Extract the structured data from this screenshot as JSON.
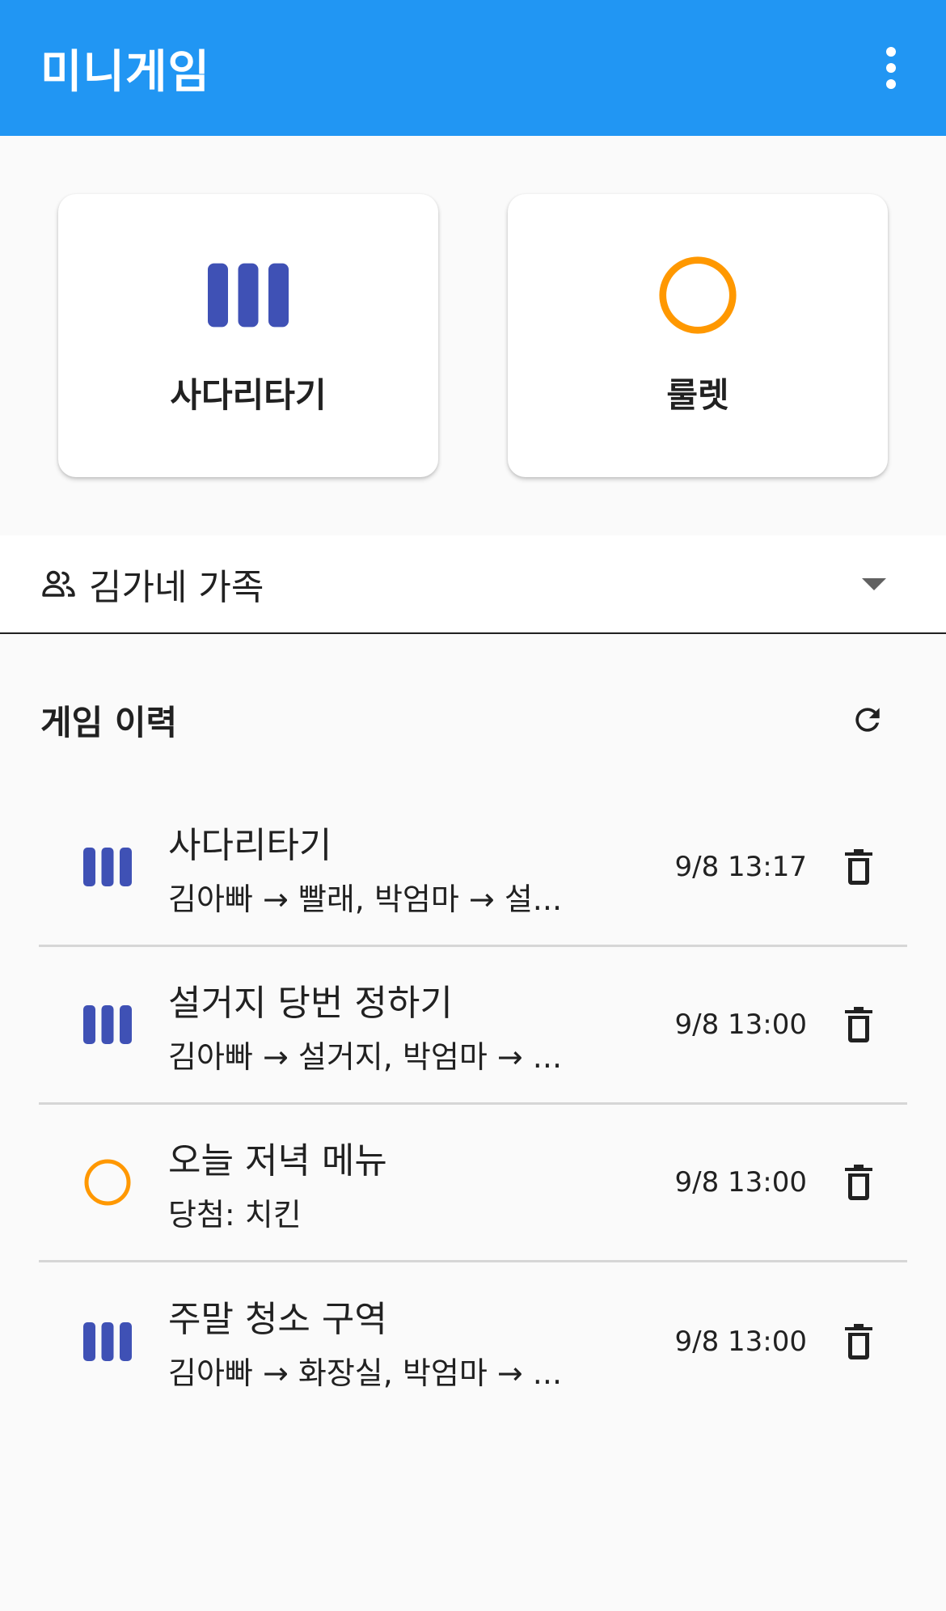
{
  "app": {
    "title": "미니게임",
    "primary_color": "#2196f3",
    "ladder_color": "#3f51b5",
    "roulette_color": "#ff9800"
  },
  "appbar": {
    "menu_icon": "more-vert-icon"
  },
  "games": [
    {
      "label": "사다리타기",
      "icon": "ladder-icon"
    },
    {
      "label": "룰렛",
      "icon": "roulette-icon"
    }
  ],
  "group": {
    "icon": "people-icon",
    "name": "김가네 가족"
  },
  "history": {
    "title": "게임 이력",
    "refresh_icon": "refresh-icon",
    "items": [
      {
        "type": "ladder",
        "icon": "ladder-icon",
        "title": "사다리타기",
        "subtitle": "김아빠 → 빨래, 박엄마 → 설...",
        "time": "9/8 13:17"
      },
      {
        "type": "ladder",
        "icon": "ladder-icon",
        "title": "설거지 당번 정하기",
        "subtitle": "김아빠 → 설거지, 박엄마 → ...",
        "time": "9/8 13:00"
      },
      {
        "type": "roulette",
        "icon": "roulette-icon",
        "title": "오늘 저녁 메뉴",
        "subtitle": "당첨: 치킨",
        "time": "9/8 13:00"
      },
      {
        "type": "ladder",
        "icon": "ladder-icon",
        "title": "주말 청소 구역",
        "subtitle": "김아빠 → 화장실, 박엄마 → ...",
        "time": "9/8 13:00"
      }
    ]
  }
}
